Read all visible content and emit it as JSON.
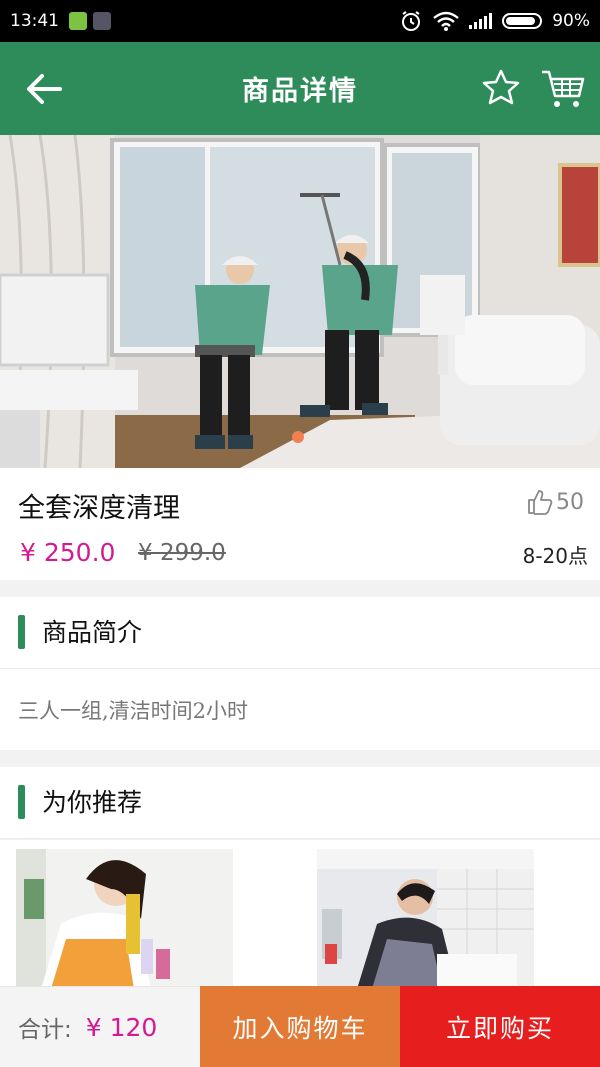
{
  "status_bar": {
    "time": "13:41",
    "battery": "90%",
    "battery_level": 0.9
  },
  "header": {
    "title": "商品详情",
    "back_icon": "arrow-left-icon",
    "favorite_icon": "star-outline-icon",
    "cart_icon": "shopping-cart-icon"
  },
  "product": {
    "name": "全套深度清理",
    "likes": "50",
    "price": "¥ 250.0",
    "original_price": "¥ 299.0",
    "service_hours": "8-20点"
  },
  "intro": {
    "title": "商品简介",
    "text": "三人一组,清洁时间2小时"
  },
  "recommend": {
    "title": "为你推荐"
  },
  "bottom_bar": {
    "total_label": "合计:",
    "total_value": "¥ 120",
    "add_to_cart": "加入购物车",
    "buy_now": "立即购买"
  },
  "colors": {
    "brand_green": "#2e8b5a",
    "price_pink": "#d41a92",
    "add_cart_orange": "#e27a36",
    "buy_red": "#e61e1e"
  }
}
